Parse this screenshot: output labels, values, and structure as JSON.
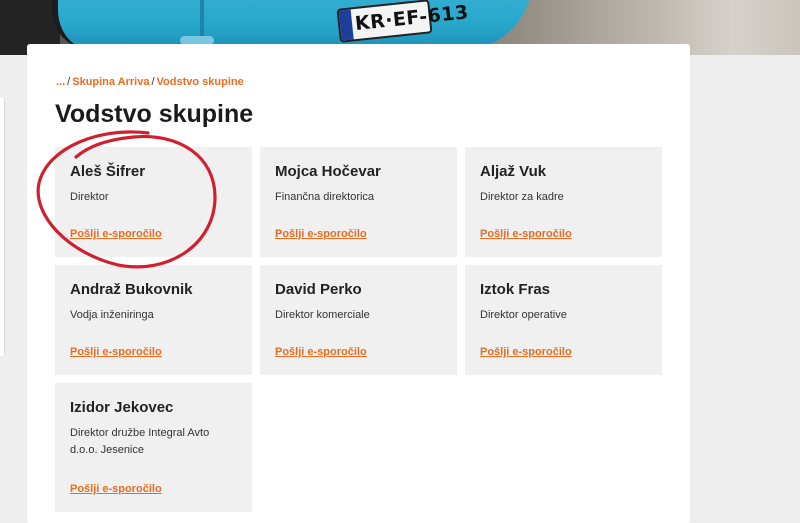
{
  "hero": {
    "plate_text": "KR·EF-613"
  },
  "breadcrumb": {
    "items": [
      "...",
      "Skupina Arriva",
      "Vodstvo skupine"
    ],
    "separator": "/"
  },
  "page": {
    "title": "Vodstvo skupine"
  },
  "people": [
    {
      "name": "Aleš Šifrer",
      "role": "Direktor",
      "link": "Pošlji e-sporočilo"
    },
    {
      "name": "Mojca Hočevar",
      "role": "Finančna direktorica",
      "link": "Pošlji e-sporočilo"
    },
    {
      "name": "Aljaž Vuk",
      "role": "Direktor za kadre",
      "link": "Pošlji e-sporočilo"
    },
    {
      "name": "Andraž Bukovnik",
      "role": "Vodja inženiringa",
      "link": "Pošlji e-sporočilo"
    },
    {
      "name": "David Perko",
      "role": "Direktor komerciale",
      "link": "Pošlji e-sporočilo"
    },
    {
      "name": "Iztok Fras",
      "role": "Direktor operative",
      "link": "Pošlji e-sporočilo"
    },
    {
      "name": "Izidor Jekovec",
      "role": "Direktor družbe Integral Avto d.o.o. Jesenice",
      "link": "Pošlji e-sporočilo"
    }
  ],
  "colors": {
    "accent": "#ec6b1f",
    "card_bg": "#f0f0f0",
    "annotation": "#d0202e"
  }
}
